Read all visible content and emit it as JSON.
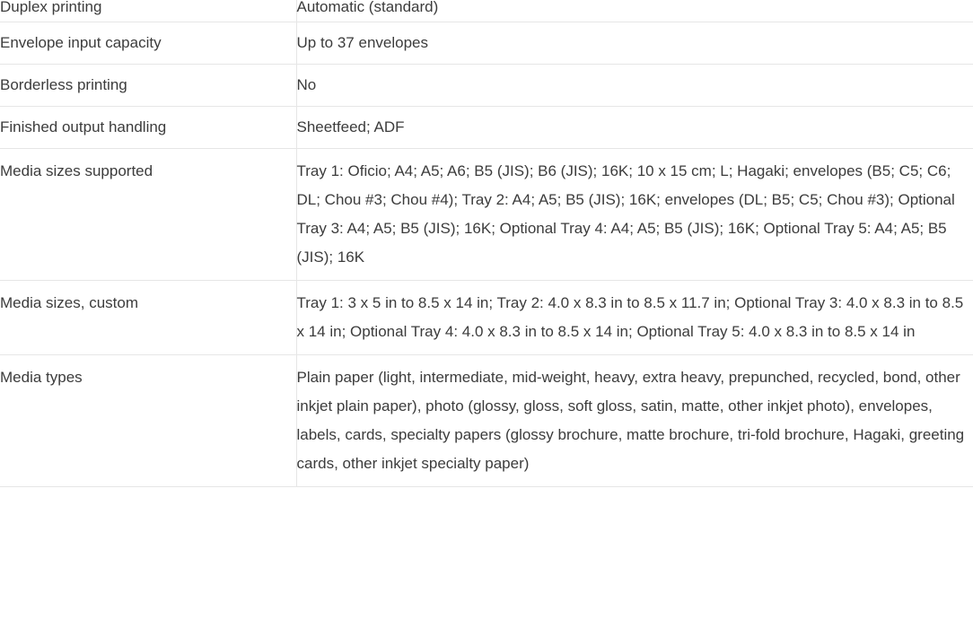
{
  "table": {
    "rows": [
      {
        "label": "Duplex printing",
        "value": "Automatic (standard)"
      },
      {
        "label": "Envelope input capacity",
        "value": "Up to 37 envelopes"
      },
      {
        "label": "Borderless printing",
        "value": "No"
      },
      {
        "label": "Finished output handling",
        "value": "Sheetfeed; ADF"
      },
      {
        "label": "Media sizes supported",
        "value": "Tray 1: Oficio; A4; A5; A6; B5 (JIS); B6 (JIS); 16K; 10 x 15 cm; L; Hagaki; envelopes (B5; C5; C6; DL; Chou #3; Chou #4); Tray 2: A4; A5; B5 (JIS); 16K; envelopes (DL; B5; C5; Chou #3); Optional Tray 3: A4; A5; B5 (JIS); 16K; Optional Tray 4: A4; A5; B5 (JIS); 16K; Optional Tray 5: A4; A5; B5 (JIS); 16K"
      },
      {
        "label": "Media sizes, custom",
        "value": "Tray 1: 3 x 5 in to 8.5 x 14 in; Tray 2: 4.0 x 8.3 in to 8.5 x 11.7 in; Optional Tray 3: 4.0 x 8.3 in to 8.5 x 14 in; Optional Tray 4: 4.0 x 8.3 in to 8.5 x 14 in; Optional Tray 5: 4.0 x 8.3 in to 8.5 x 14 in"
      },
      {
        "label": "Media types",
        "value": "Plain paper (light, intermediate, mid-weight, heavy, extra heavy, prepunched, recycled, bond, other inkjet plain paper), photo (glossy, gloss, soft gloss, satin, matte, other inkjet photo), envelopes, labels, cards, specialty papers (glossy brochure, matte brochure, tri-fold brochure, Hagaki, greeting cards, other inkjet specialty paper)"
      }
    ]
  },
  "colors": {
    "text": "#3c3c3c",
    "divider": "#e6e6e6",
    "background": "#ffffff"
  }
}
